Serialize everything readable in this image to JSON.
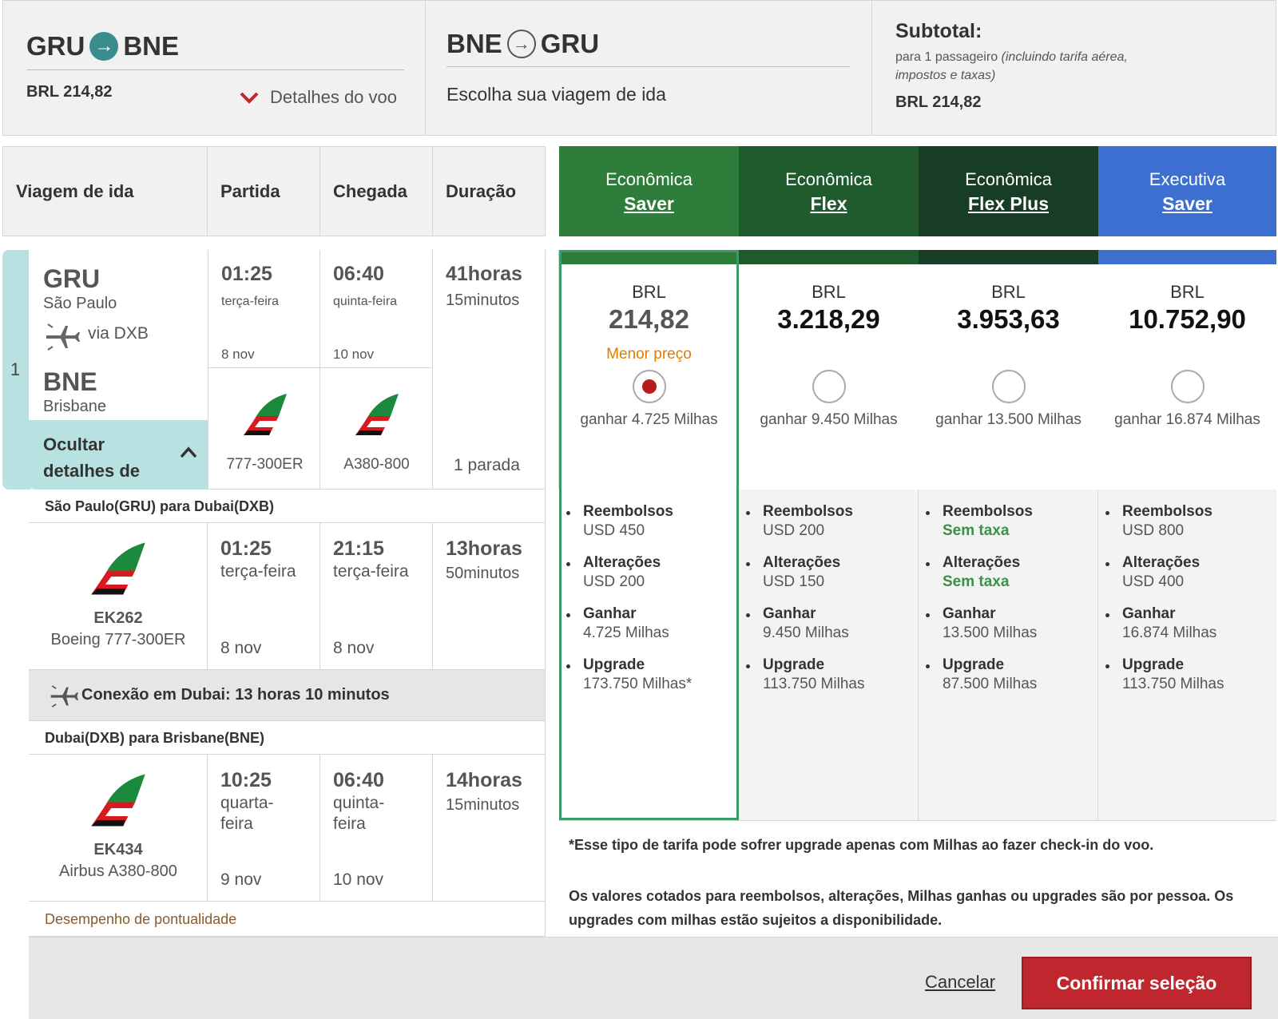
{
  "summary": {
    "outbound": {
      "from": "GRU",
      "to": "BNE",
      "price": "BRL 214,82",
      "details_label": "Detalhes do voo"
    },
    "inbound": {
      "from": "BNE",
      "to": "GRU",
      "prompt": "Escolha sua viagem de ida"
    },
    "subtotal": {
      "title": "Subtotal:",
      "note_plain": "para 1 passageiro",
      "note_italic_1": "(incluindo tarifa aérea,",
      "note_italic_2": "impostos e taxas)",
      "amount": "BRL 214,82"
    }
  },
  "table_header": {
    "trip": "Viagem de ida",
    "departure": "Partida",
    "arrival": "Chegada",
    "duration": "Duração"
  },
  "fares": [
    {
      "cabin": "Econômica",
      "type": "Saver",
      "color": "#2e7d3a",
      "currency": "BRL",
      "price": "214,82",
      "tag": "Menor preço",
      "earn": "ganhar 4.725 Milhas",
      "selected": true,
      "refunds_label": "Reembolsos",
      "refunds": "USD 450",
      "changes_label": "Alterações",
      "changes": "USD 200",
      "earn_label": "Ganhar",
      "earn_miles": "4.725 Milhas",
      "upgrade_label": "Upgrade",
      "upgrade": "173.750 Milhas*"
    },
    {
      "cabin": "Econômica",
      "type": "Flex",
      "color": "#1f5b2c",
      "currency": "BRL",
      "price": "3.218,29",
      "earn": "ganhar 9.450 Milhas",
      "selected": false,
      "refunds_label": "Reembolsos",
      "refunds": "USD 200",
      "changes_label": "Alterações",
      "changes": "USD 150",
      "earn_label": "Ganhar",
      "earn_miles": "9.450 Milhas",
      "upgrade_label": "Upgrade",
      "upgrade": "113.750 Milhas"
    },
    {
      "cabin": "Econômica",
      "type": "Flex Plus",
      "color": "#173d26",
      "currency": "BRL",
      "price": "3.953,63",
      "earn": "ganhar 13.500 Milhas",
      "selected": false,
      "refunds_label": "Reembolsos",
      "refunds": "Sem taxa",
      "changes_label": "Alterações",
      "changes": "Sem taxa",
      "earn_label": "Ganhar",
      "earn_miles": "13.500 Milhas",
      "upgrade_label": "Upgrade",
      "upgrade": "87.500 Milhas"
    },
    {
      "cabin": "Executiva",
      "type": "Saver",
      "color": "#3d6fd1",
      "currency": "BRL",
      "price": "10.752,90",
      "earn": "ganhar 16.874 Milhas",
      "selected": false,
      "refunds_label": "Reembolsos",
      "refunds": "USD 800",
      "changes_label": "Alterações",
      "changes": "USD 400",
      "earn_label": "Ganhar",
      "earn_miles": "16.874 Milhas",
      "upgrade_label": "Upgrade",
      "upgrade": "113.750 Milhas"
    }
  ],
  "flight": {
    "index": "1",
    "origin_code": "GRU",
    "origin_city": "São Paulo",
    "via": "via DXB",
    "dest_code": "BNE",
    "dest_city": "Brisbane",
    "hide_details": "Ocultar detalhes de",
    "dep_time": "01:25",
    "dep_day": "terça-feira",
    "dep_date": "8 nov",
    "arr_time": "06:40",
    "arr_day": "quinta-feira",
    "arr_date": "10 nov",
    "dur_hours": "41horas",
    "dur_minutes": "15minutos",
    "aircraft_1": "777-300ER",
    "aircraft_2": "A380-800",
    "stops": "1 parada"
  },
  "segments": [
    {
      "title": "São Paulo(GRU) para Dubai(DXB)",
      "flight_no": "EK262",
      "aircraft": "Boeing 777-300ER",
      "dep_time": "01:25",
      "dep_day": "terça-feira",
      "dep_date": "8 nov",
      "arr_time": "21:15",
      "arr_day": "terça-feira",
      "arr_date": "8 nov",
      "dur_hours": "13horas",
      "dur_minutes": "50minutos"
    },
    {
      "title": "Dubai(DXB) para Brisbane(BNE)",
      "flight_no": "EK434",
      "aircraft": "Airbus A380-800",
      "dep_time": "10:25",
      "dep_day_1": "quarta-",
      "dep_day_2": "feira",
      "dep_date": "9 nov",
      "arr_time": "06:40",
      "arr_day_1": "quinta-",
      "arr_day_2": "feira",
      "arr_date": "10 nov",
      "dur_hours": "14horas",
      "dur_minutes": "15minutos"
    }
  ],
  "connection": "Conexão em Dubai: 13 horas 10 minutos",
  "punctuality": "Desempenho de pontualidade",
  "notes": {
    "note1": "*Esse tipo de tarifa pode sofrer upgrade apenas com Milhas ao fazer check-in do voo.",
    "note2": "Os valores cotados para reembolsos, alterações, Milhas ganhas ou upgrades são por pessoa. Os upgrades com milhas estão sujeitos a disponibilidade."
  },
  "actions": {
    "cancel": "Cancelar",
    "confirm": "Confirmar seleção"
  }
}
